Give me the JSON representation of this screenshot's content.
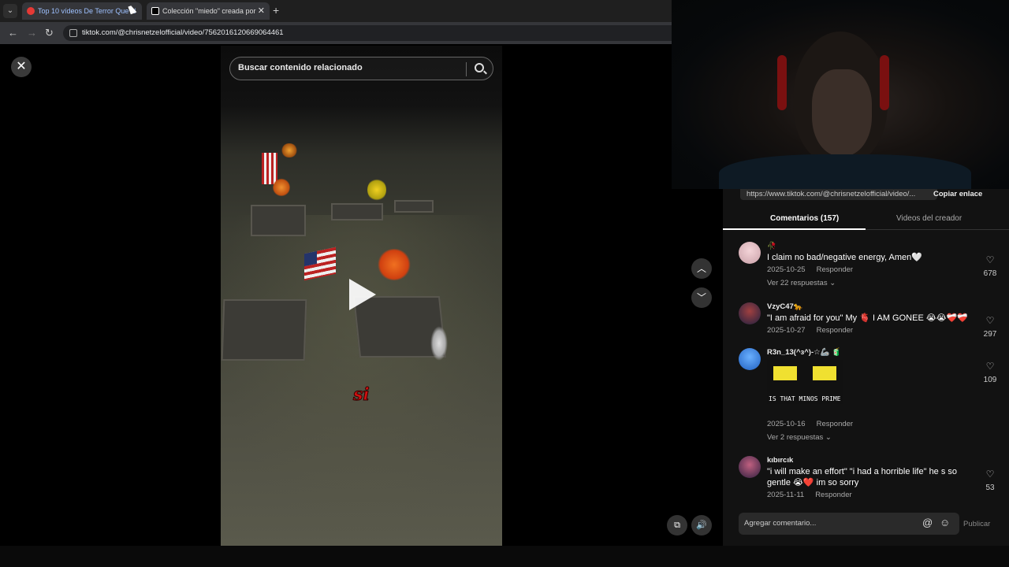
{
  "browser": {
    "tabs": [
      {
        "label": "Top 10 vídeos De Terror Que N"
      },
      {
        "label": "Colección \"miedo\" creada por"
      }
    ],
    "url": "tiktok.com/@chrisnetzelofficial/video/7562016120669064461"
  },
  "search": {
    "placeholder": "Buscar contenido relacionado"
  },
  "video_overlay": {
    "squiggle_text": "si"
  },
  "panel": {
    "link_url": "https://www.tiktok.com/@chrisnetzelofficial/video/...",
    "copy_label": "Copiar enlace",
    "tab_comments": "Comentarios (157)",
    "tab_creator": "Videos del creador",
    "reply_label": "Responder",
    "comments": [
      {
        "user": "🥀",
        "text": "I claim no bad/negative energy, Amen🤍",
        "date": "2025-10-25",
        "likes": "678",
        "replies": "Ver 22 respuestas ⌄"
      },
      {
        "user": "VzyC47🐆",
        "text": "\"I am afraid for you\" My 🫀 I AM GONEE 😭😭❤️‍🩹❤️‍🩹",
        "date": "2025-10-27",
        "likes": "297"
      },
      {
        "user": "R3n_13(^з^)-☆🦾 🧃",
        "text": "",
        "meme_text": "IS THAT MINOS PRIME",
        "date": "2025-10-16",
        "likes": "109",
        "replies": "Ver 2 respuestas ⌄"
      },
      {
        "user": "kıbırcık",
        "text": "\"i will make an effort\" \"i had a horrible life\" he s so gentle 😭❤️ im so sorry",
        "date": "2025-11-11",
        "likes": "53"
      }
    ],
    "input_placeholder": "Agregar comentario...",
    "publish_label": "Publicar"
  },
  "colors": {
    "accent": "#fe2c55",
    "panel_bg": "#121212"
  },
  "icons": [
    "close-icon",
    "search-icon",
    "chevron-up-icon",
    "chevron-down-icon",
    "heart-icon",
    "at-icon",
    "emoji-icon",
    "volume-icon",
    "pip-icon"
  ]
}
